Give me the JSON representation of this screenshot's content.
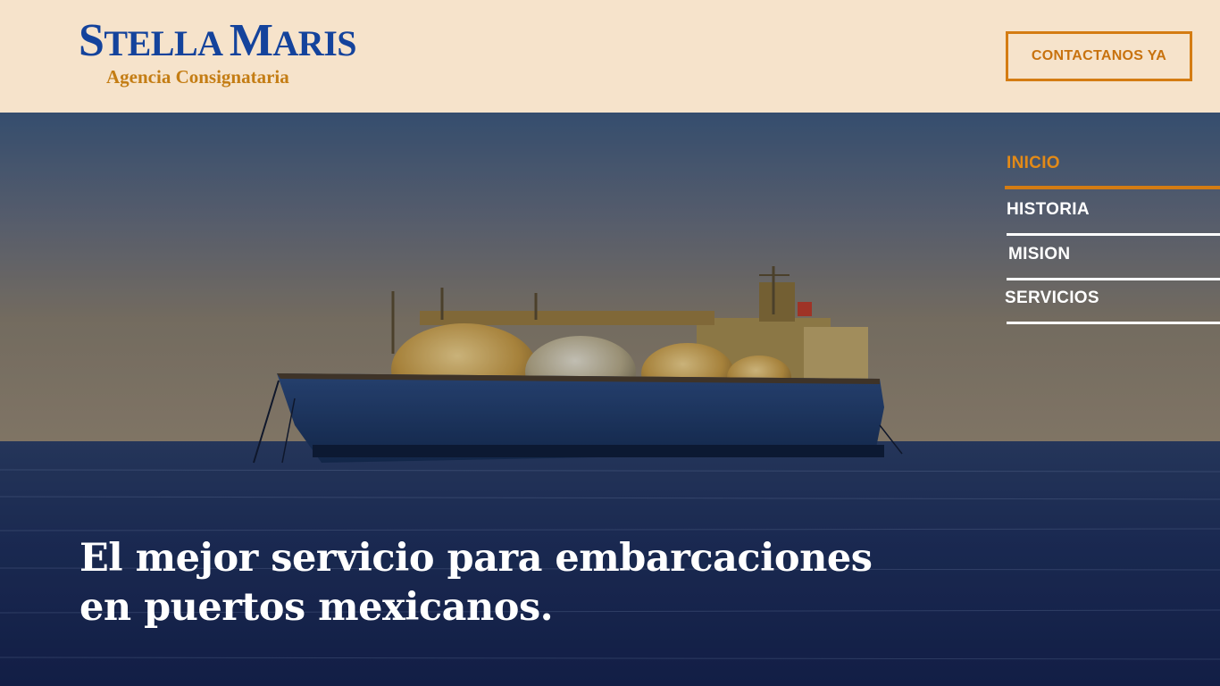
{
  "header": {
    "logo_name_1": "S",
    "logo_name_2": "TELLA ",
    "logo_name_3": "M",
    "logo_name_4": "ARIS",
    "logo_subtitle": "Agencia Consignataria",
    "cta_label": "CONTACTANOS YA"
  },
  "nav": {
    "items": [
      {
        "label": "INICIO",
        "active": true
      },
      {
        "label": "HISTORIA",
        "active": false
      },
      {
        "label": "MISION",
        "active": false
      },
      {
        "label": "SERVICIOS",
        "active": false
      }
    ]
  },
  "hero": {
    "headline_line1": "El mejor servicio para embarcaciones",
    "headline_line2": "en puertos mexicanos."
  },
  "colors": {
    "header_bg": "#f6e3cb",
    "brand_blue": "#14439c",
    "brand_orange": "#d47c12"
  }
}
